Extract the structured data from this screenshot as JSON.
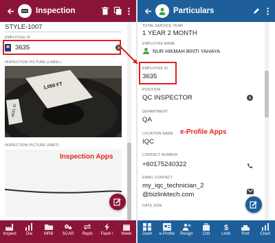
{
  "left_app": {
    "title": "Inspection",
    "style_code": "STYLE-1007",
    "employee_id_label": "EMPLOYEE ID",
    "employee_id_value": "3635",
    "picture_label_title": "INSPECTION PICTURE (LABEL)",
    "picture_part_title": "INSPECTION PICTURE (PART)",
    "reel_label_text": "1,000 FT",
    "reel_label_side": "REEL ID",
    "caption": "Inspection Apps",
    "caption_color": "#e0241b",
    "nav": [
      {
        "label": "Inspect",
        "icon": "factory-icon"
      },
      {
        "label": "Dia",
        "icon": "chart-icon"
      },
      {
        "label": "MRB",
        "icon": "folder-icon"
      },
      {
        "label": "SCAR",
        "icon": "gears-icon"
      },
      {
        "label": "Replc",
        "icon": "replace-icon"
      },
      {
        "label": "Flash !",
        "icon": "flash-icon"
      },
      {
        "label": "Week",
        "icon": "calendar-icon"
      }
    ],
    "colors": {
      "primary": "#8b1538",
      "fab": "#8b1538"
    }
  },
  "right_app": {
    "title": "Particulars",
    "total_service_label": "TOTAL SERVICE YEAR",
    "total_service_value": "1 YEAR 2 MONTH",
    "employee_name_label": "EMPLOYEE NAME",
    "employee_name_value": "NUR HIKMAH BINTI YAHAYA",
    "employee_id_label": "EMPLOYEE ID",
    "employee_id_value": "3635",
    "position_label": "POSITION",
    "position_value": "QC INSPECTOR",
    "department_label": "DEPARTMENT",
    "department_value": "QA",
    "location_label": "LOCATION NAME",
    "location_value": "IQC",
    "contact_label": "CONTACT NUMBER",
    "contact_value": "+60175240322",
    "email_label": "EMAIL CONTACT",
    "email_value_line1": "my_iqc_technician_2",
    "email_value_line2": "@bizlinktech.com",
    "date_join_label": "DATE JOIN",
    "caption": "e-Profile Apps",
    "caption_color": "#e0241b",
    "nav": [
      {
        "label": "Dash",
        "icon": "dashboard-icon"
      },
      {
        "label": "e-Profile",
        "icon": "profile-icon"
      },
      {
        "label": "Resign",
        "icon": "resign-icon"
      },
      {
        "label": "Chit",
        "icon": "chit-icon"
      },
      {
        "label": "Limit",
        "icon": "limit-icon"
      },
      {
        "label": "Port",
        "icon": "port-icon"
      },
      {
        "label": "Chart",
        "icon": "chart-icon"
      }
    ],
    "colors": {
      "primary": "#1e5f9a",
      "fab": "#1e5f9a"
    }
  }
}
